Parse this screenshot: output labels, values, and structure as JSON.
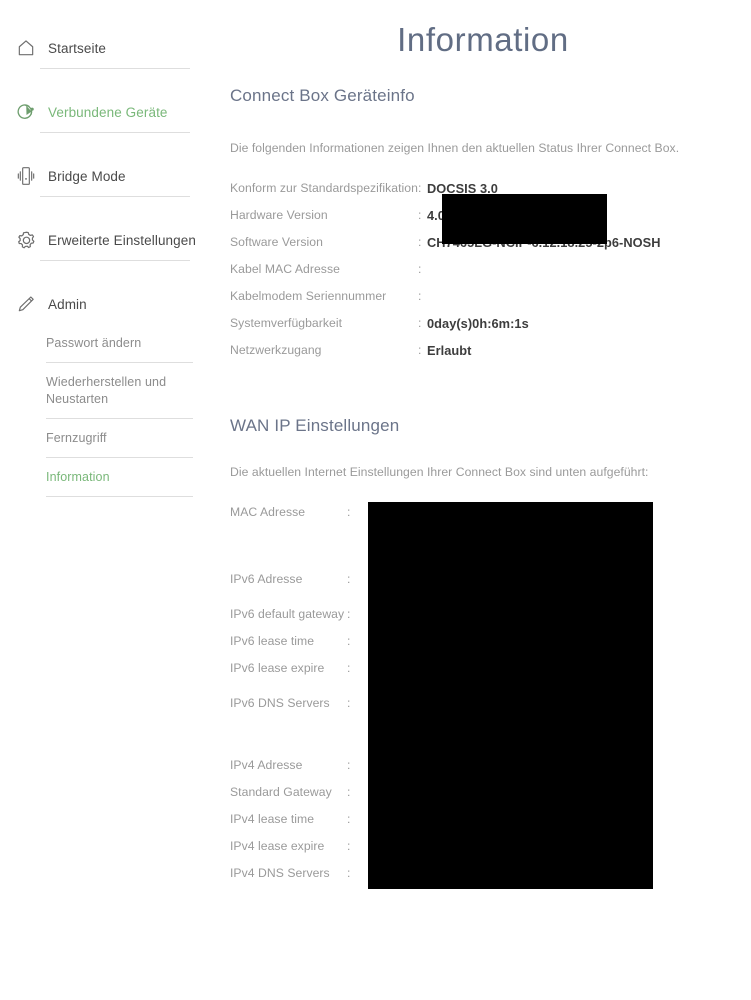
{
  "sidebar": {
    "items": [
      {
        "label": "Startseite",
        "icon": "home-icon",
        "active": false
      },
      {
        "label": "Verbundene Geräte",
        "icon": "connected-devices-icon",
        "active": true
      },
      {
        "label": "Bridge Mode",
        "icon": "modem-device-icon",
        "active": false
      },
      {
        "label": "Erweiterte Einstellungen",
        "icon": "gear-icon",
        "active": false
      },
      {
        "label": "Admin",
        "icon": "pencil-icon",
        "active": false
      }
    ],
    "sub_items": [
      {
        "label": "Passwort ändern",
        "active": false
      },
      {
        "label": "Wiederherstellen und Neustarten",
        "active": false
      },
      {
        "label": "Fernzugriff",
        "active": false
      },
      {
        "label": "Information",
        "active": true
      }
    ]
  },
  "main": {
    "page_title": "Information",
    "device_section": {
      "title": "Connect Box Geräteinfo",
      "description": "Die folgenden Informationen zeigen Ihnen den aktuellen Status Ihrer Connect Box.",
      "rows": [
        {
          "label": "Konform zur Standardspezifikation",
          "colon": ":",
          "value": "DOCSIS 3.0",
          "redacted": false
        },
        {
          "label": "Hardware Version",
          "colon": ":",
          "value": "4.01",
          "redacted": false
        },
        {
          "label": "Software Version",
          "colon": ":",
          "value": "CH7465LG-NCIP-6.12.18.25-2p6-NOSH",
          "redacted": false
        },
        {
          "label": "Kabel MAC Adresse",
          "colon": ":",
          "value": "",
          "redacted": true
        },
        {
          "label": "Kabelmodem Seriennummer",
          "colon": ":",
          "value": "",
          "redacted": true
        },
        {
          "label": "Systemverfügbarkeit",
          "colon": ":",
          "value": "0day(s)0h:6m:1s",
          "redacted": false
        },
        {
          "label": "Netzwerkzugang",
          "colon": ":",
          "value": "Erlaubt",
          "redacted": false
        }
      ]
    },
    "wan_section": {
      "title": "WAN IP Einstellungen",
      "description": "Die aktuellen Internet Einstellungen Ihrer Connect Box sind unten aufgeführt:",
      "rows": [
        {
          "label": "MAC Adresse",
          "colon": ":",
          "value": "",
          "redacted": true
        },
        {
          "label": "IPv6 Adresse",
          "colon": ":",
          "value": "",
          "redacted": true
        },
        {
          "label": "IPv6 default gateway",
          "colon": ":",
          "value": "",
          "redacted": true
        },
        {
          "label": "IPv6 lease time",
          "colon": ":",
          "value": "",
          "redacted": true
        },
        {
          "label": "IPv6 lease expire",
          "colon": ":",
          "value": "",
          "redacted": true
        },
        {
          "label": "IPv6 DNS Servers",
          "colon": ":",
          "value": "",
          "redacted": true
        },
        {
          "label": "IPv4 Adresse",
          "colon": ":",
          "value": "",
          "redacted": true
        },
        {
          "label": "Standard Gateway",
          "colon": ":",
          "value": "",
          "redacted": true
        },
        {
          "label": "IPv4 lease time",
          "colon": ":",
          "value": "",
          "redacted": true
        },
        {
          "label": "IPv4 lease expire",
          "colon": ":",
          "value": "",
          "redacted": true
        },
        {
          "label": "IPv4 DNS Servers",
          "colon": ":",
          "value": "",
          "redacted": true
        }
      ]
    }
  },
  "colors": {
    "accent_green": "#7ab87a",
    "title_slate": "#616d84",
    "label_gray": "#9a9a9a",
    "value_dark": "#3d3d3d",
    "divider": "#dedede",
    "redaction": "#000000"
  }
}
